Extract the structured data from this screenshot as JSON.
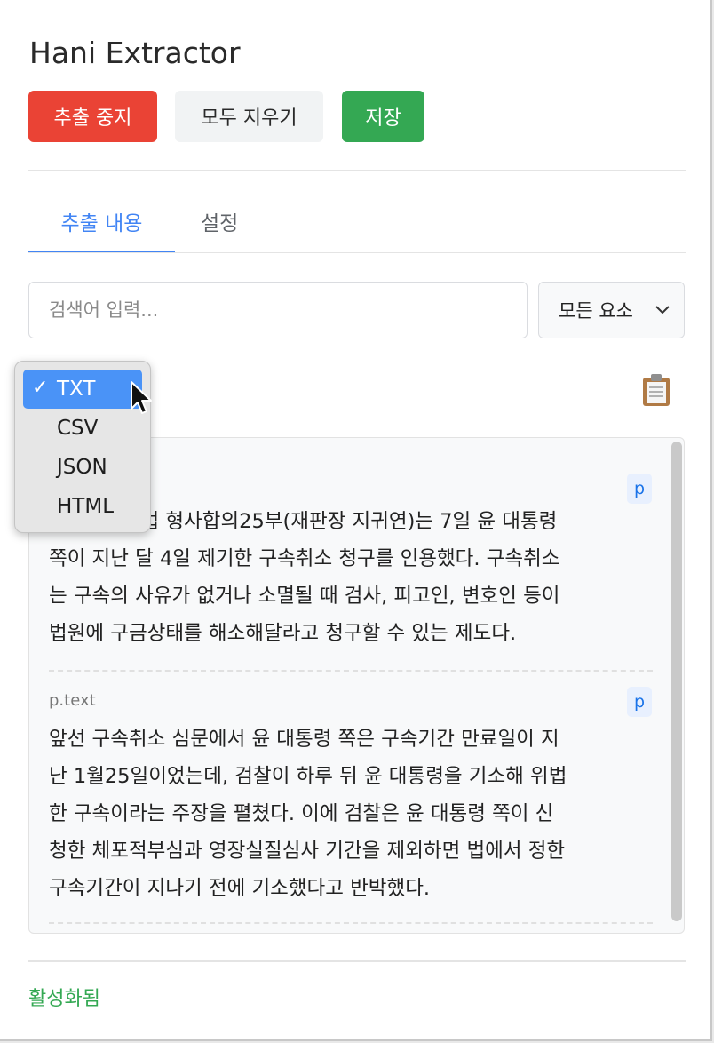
{
  "app": {
    "title": "Hani Extractor"
  },
  "toolbar": {
    "stop_label": "추출 중지",
    "clear_label": "모두 지우기",
    "save_label": "저장"
  },
  "tabs": [
    {
      "label": "추출 내용",
      "active": true
    },
    {
      "label": "설정",
      "active": false
    }
  ],
  "search": {
    "placeholder": "검색어 입력...",
    "value": ""
  },
  "filter": {
    "selected": "모든 요소"
  },
  "format_menu": {
    "check": "✓",
    "options": [
      {
        "label": "TXT",
        "selected": true
      },
      {
        "label": "CSV"
      },
      {
        "label": "JSON"
      },
      {
        "label": "HTML"
      }
    ]
  },
  "items": [
    {
      "badge": "p",
      "lines": [
        "서울중앙지법 형사합의25부(재판장 지귀연)는 7일 윤 대통령",
        "쪽이 지난 달 4일 제기한 구속취소 청구를 인용했다. 구속취소",
        "는 구속의 사유가 없거나 소멸될 때 검사, 피고인, 변호인 등이",
        "법원에 구금상태를 해소해달라고 청구할 수 있는 제도다."
      ]
    },
    {
      "tag": "p.text",
      "badge": "p",
      "lines": [
        "앞선 구속취소 심문에서 윤 대통령 쪽은 구속기간 만료일이 지",
        "난 1월25일이었는데, 검찰이 하루 뒤 윤 대통령을 기소해 위법",
        "한 구속이라는 주장을 펼쳤다. 이에 검찰은 윤 대통령 쪽이 신",
        "청한 체포적부심과 영장실질심사 기간을 제외하면 법에서 정한",
        "구속기간이 지나기 전에 기소했다고 반박했다."
      ]
    }
  ],
  "status": {
    "text": "활성화됨"
  },
  "colors": {
    "accent": "#4285f4",
    "danger": "#ea4335",
    "success": "#34a853",
    "menu_highlight": "#4a93f7"
  },
  "icons": {
    "copy": "clipboard-icon",
    "dropdown": "chevron-down-icon",
    "pointer": "mouse-cursor-icon"
  }
}
